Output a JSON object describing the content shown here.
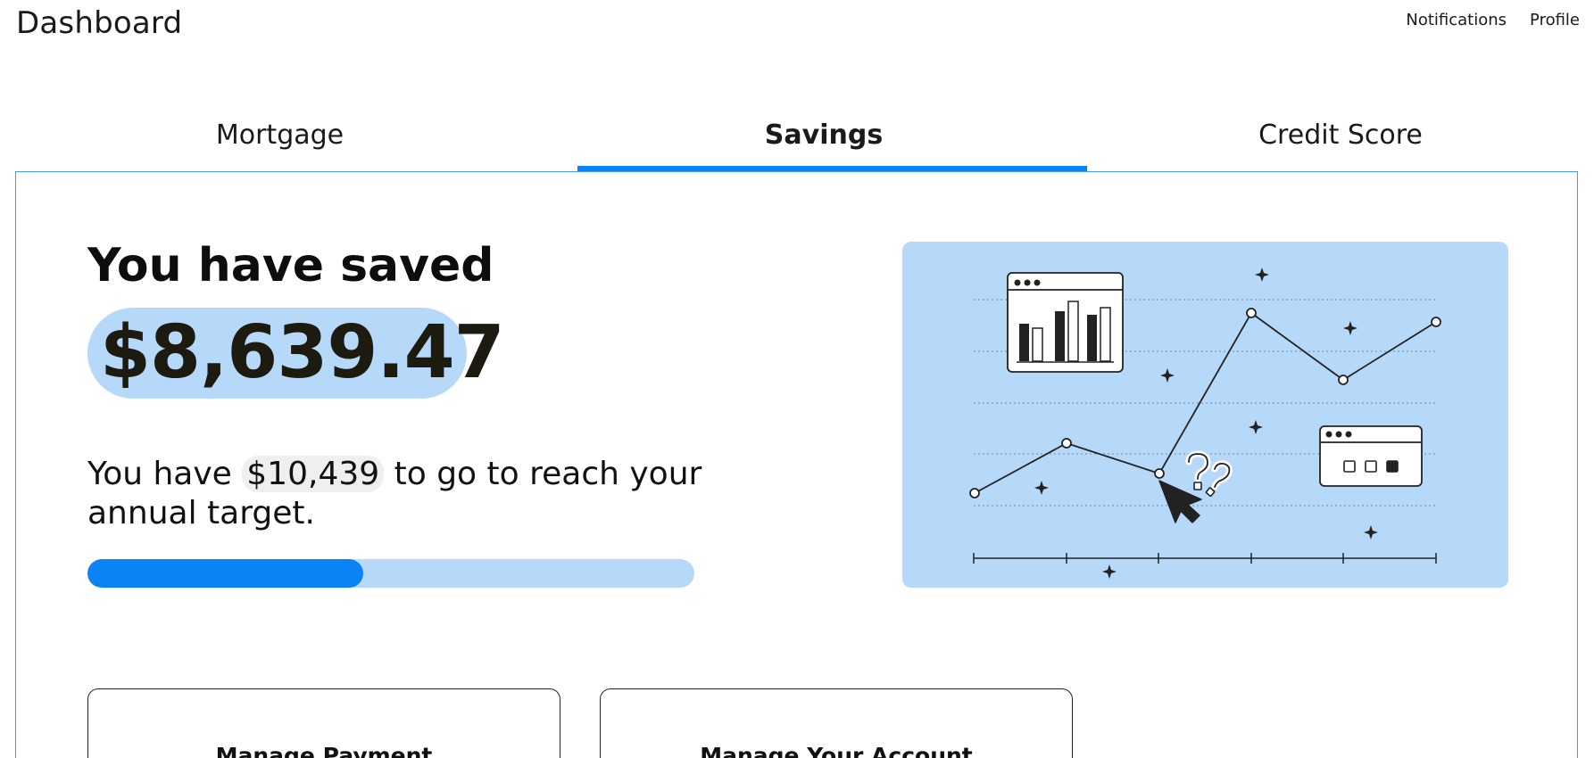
{
  "header": {
    "title": "Dashboard",
    "nav": [
      "Notifications",
      "Profile"
    ]
  },
  "tabs": [
    {
      "label": "Mortgage",
      "active": false
    },
    {
      "label": "Savings",
      "active": true
    },
    {
      "label": "Credit Score",
      "active": false
    }
  ],
  "savings": {
    "heading": "You have saved",
    "amount": "$8,639.47",
    "remaining_prefix": "You have",
    "remaining_amount": "$10,439",
    "remaining_suffix": "to go to reach your annual target.",
    "progress_fraction": 0.455
  },
  "illustration": {
    "icons": [
      "bar-chart-window-icon",
      "browser-window-icon",
      "cursor-arrow-icon",
      "question-marks-icon",
      "sparkle-icon"
    ]
  },
  "actions": [
    "Manage Payment",
    "Manage Your Account"
  ],
  "colors": {
    "accent": "#0a84f5",
    "accent_light": "#b6d9fa",
    "panel_border": "#3d9bf0"
  }
}
